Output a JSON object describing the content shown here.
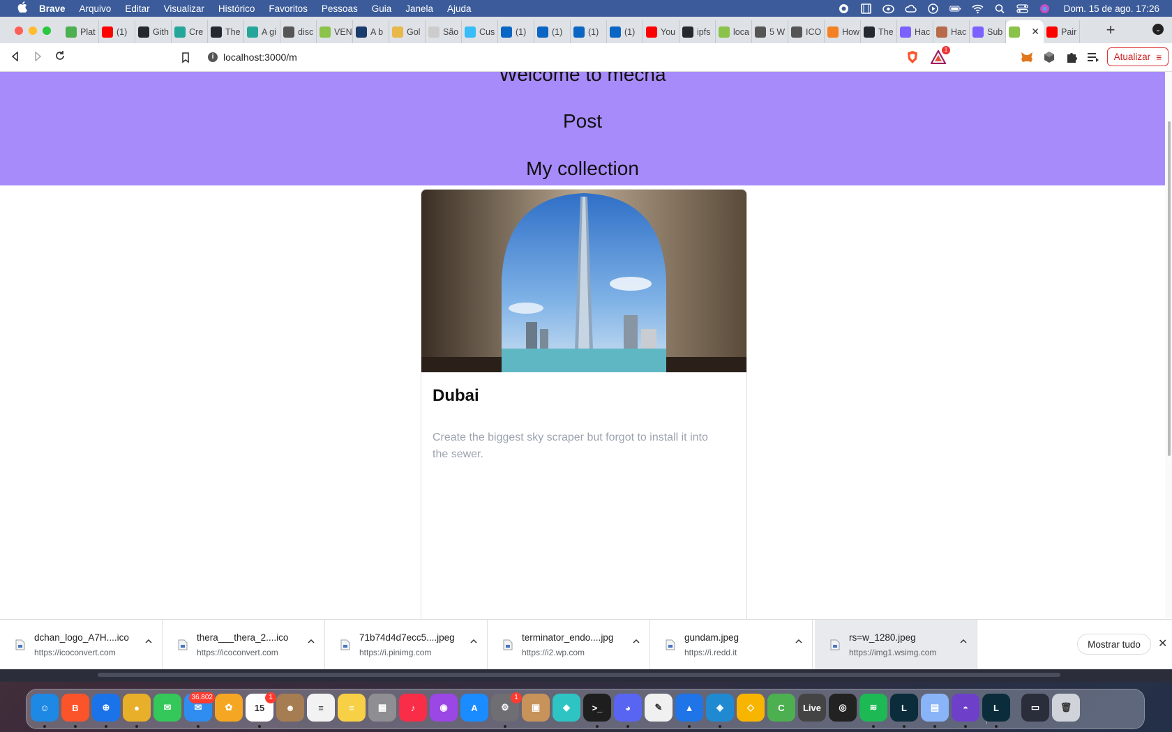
{
  "menubar": {
    "app_name": "Brave",
    "items": [
      "Arquivo",
      "Editar",
      "Visualizar",
      "Histórico",
      "Favoritos",
      "Pessoas",
      "Guia",
      "Janela",
      "Ajuda"
    ],
    "clock": "Dom. 15 de ago.  17:26"
  },
  "tabs": [
    {
      "label": "Plat",
      "color": "#4caf50"
    },
    {
      "label": "(1)",
      "color": "#ff0000"
    },
    {
      "label": "Gith",
      "color": "#24292f"
    },
    {
      "label": "Cre",
      "color": "#26a69a"
    },
    {
      "label": "The",
      "color": "#24292f"
    },
    {
      "label": "A gi",
      "color": "#26a69a"
    },
    {
      "label": "disc",
      "color": "#555555"
    },
    {
      "label": "VEN",
      "color": "#8bc34a"
    },
    {
      "label": "A b",
      "color": "#1a3a6b"
    },
    {
      "label": "Gol",
      "color": "#e8b84a"
    },
    {
      "label": "São",
      "color": "#cccccc"
    },
    {
      "label": "Cus",
      "color": "#38bdf8"
    },
    {
      "label": "(1)",
      "color": "#0a66c2"
    },
    {
      "label": "(1)",
      "color": "#0a66c2"
    },
    {
      "label": "(1)",
      "color": "#0a66c2"
    },
    {
      "label": "(1)",
      "color": "#0a66c2"
    },
    {
      "label": "You",
      "color": "#ff0000"
    },
    {
      "label": "ipfs",
      "color": "#24292f"
    },
    {
      "label": "loca",
      "color": "#8bc34a"
    },
    {
      "label": "5 W",
      "color": "#555555"
    },
    {
      "label": "ICO",
      "color": "#555555"
    },
    {
      "label": "How",
      "color": "#f48024"
    },
    {
      "label": "The",
      "color": "#24292f"
    },
    {
      "label": "Hac",
      "color": "#7b61ff"
    },
    {
      "label": "Hac",
      "color": "#b86b4a"
    },
    {
      "label": "Sub",
      "color": "#7b61ff"
    },
    {
      "label": "",
      "color": "#8bc34a",
      "active": true
    },
    {
      "label": "Pair",
      "color": "#ff0000"
    }
  ],
  "toolbar": {
    "url": "localhost:3000/m",
    "update_label": "Atualizar",
    "rewards_badge": "1"
  },
  "page": {
    "hero_links": [
      "Welcome to mecha",
      "Post",
      "My collection"
    ],
    "hero_color": "#a78bfa",
    "card": {
      "title": "Dubai",
      "description": "Create the biggest sky scraper but forgot to install it into the sewer."
    }
  },
  "downloads": {
    "items": [
      {
        "name": "dchan_logo_A7H....ico",
        "source": "https://icoconvert.com"
      },
      {
        "name": "thera___thera_2....ico",
        "source": "https://icoconvert.com"
      },
      {
        "name": "71b74d4d7ecc5....jpeg",
        "source": "https://i.pinimg.com"
      },
      {
        "name": "terminator_endo....jpg",
        "source": "https://i2.wp.com"
      },
      {
        "name": "gundam.jpeg",
        "source": "https://i.redd.it"
      },
      {
        "name": "rs=w_1280.jpeg",
        "source": "https://img1.wsimg.com"
      }
    ],
    "show_all_label": "Mostrar tudo"
  },
  "dock": {
    "apps": [
      {
        "name": "finder",
        "color": "#1e88e5",
        "glyph": "☺",
        "running": true
      },
      {
        "name": "brave",
        "color": "#fb542b",
        "glyph": "B",
        "running": true
      },
      {
        "name": "safari",
        "color": "#1a73e8",
        "glyph": "⊕",
        "running": true
      },
      {
        "name": "chrome",
        "color": "#e8b02a",
        "glyph": "●",
        "running": true
      },
      {
        "name": "messages",
        "color": "#34c759",
        "glyph": "✉",
        "running": false
      },
      {
        "name": "mail",
        "color": "#2f8cf0",
        "glyph": "✉",
        "running": true,
        "badge": "36.802"
      },
      {
        "name": "photos",
        "color": "#f5a623",
        "glyph": "✿",
        "running": false
      },
      {
        "name": "calendar",
        "color": "#ffffff",
        "glyph": "15",
        "running": true,
        "badge": "1"
      },
      {
        "name": "contacts",
        "color": "#a67c52",
        "glyph": "☻",
        "running": false
      },
      {
        "name": "reminders",
        "color": "#f2f2f2",
        "glyph": "≡",
        "running": false
      },
      {
        "name": "notes",
        "color": "#f7d046",
        "glyph": "≡",
        "running": false
      },
      {
        "name": "launchpad",
        "color": "#8e8e93",
        "glyph": "▦",
        "running": false
      },
      {
        "name": "music",
        "color": "#fa2d48",
        "glyph": "♪",
        "running": false
      },
      {
        "name": "podcasts",
        "color": "#9b47e6",
        "glyph": "◉",
        "running": false
      },
      {
        "name": "app-store",
        "color": "#1a8cff",
        "glyph": "A",
        "running": false
      },
      {
        "name": "system-preferences",
        "color": "#6e6e73",
        "glyph": "⚙",
        "running": true,
        "badge": "1"
      },
      {
        "name": "archive-utility",
        "color": "#c8935a",
        "glyph": "▣",
        "running": false
      },
      {
        "name": "cube-app",
        "color": "#2ec4c4",
        "glyph": "◆",
        "running": false
      },
      {
        "name": "terminal",
        "color": "#1e1e1e",
        "glyph": ">_",
        "running": true
      },
      {
        "name": "discord",
        "color": "#5865f2",
        "glyph": "◕",
        "running": true
      },
      {
        "name": "script-editor",
        "color": "#f0f0f0",
        "glyph": "✎",
        "running": false
      },
      {
        "name": "keynote",
        "color": "#1f74e8",
        "glyph": "▲",
        "running": true
      },
      {
        "name": "vscode",
        "color": "#1f8ad2",
        "glyph": "◈",
        "running": true
      },
      {
        "name": "sketch",
        "color": "#f7b500",
        "glyph": "◇",
        "running": false
      },
      {
        "name": "camtasia",
        "color": "#4caf50",
        "glyph": "C",
        "running": false
      },
      {
        "name": "ableton-live",
        "color": "#444444",
        "glyph": "Live",
        "running": false
      },
      {
        "name": "unity",
        "color": "#222222",
        "glyph": "◎",
        "running": false
      },
      {
        "name": "spotify",
        "color": "#1db954",
        "glyph": "≋",
        "running": true
      },
      {
        "name": "league-of-legends",
        "color": "#0b2c3a",
        "glyph": "L",
        "running": true
      },
      {
        "name": "preview",
        "color": "#8ab4f8",
        "glyph": "▤",
        "running": true
      },
      {
        "name": "github-desktop",
        "color": "#6e40c9",
        "glyph": "◓",
        "running": true
      },
      {
        "name": "league-client",
        "color": "#0b2c3a",
        "glyph": "L",
        "running": true
      },
      {
        "name": "screenshot-stack",
        "color": "#2a2d3a",
        "glyph": "▭",
        "running": false
      },
      {
        "name": "trash",
        "color": "#d0d4da",
        "glyph": "🗑",
        "running": false
      }
    ]
  }
}
